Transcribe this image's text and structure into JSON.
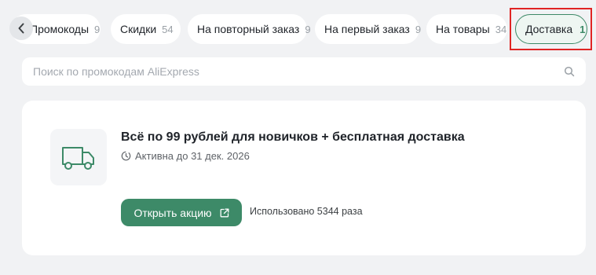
{
  "tabs": [
    {
      "label": "Промокоды",
      "count": "9"
    },
    {
      "label": "Скидки",
      "count": "54"
    },
    {
      "label": "На повторный заказ",
      "count": "9"
    },
    {
      "label": "На первый заказ",
      "count": "9"
    },
    {
      "label": "На товары",
      "count": "34"
    },
    {
      "label": "Доставка",
      "count": "1",
      "active": true
    }
  ],
  "search": {
    "placeholder": "Поиск по промокодам AliExpress"
  },
  "promo": {
    "title": "Всё по 99 рублей для новичков + бесплатная доставка",
    "status": "Активна до 31 дек. 2026",
    "button_label": "Открыть акцию",
    "usage": "Использовано 5344 раза",
    "icon": "delivery-truck-icon"
  },
  "colors": {
    "accent": "#3d8a68",
    "highlight": "#e02424",
    "background": "#f1f2f4"
  }
}
